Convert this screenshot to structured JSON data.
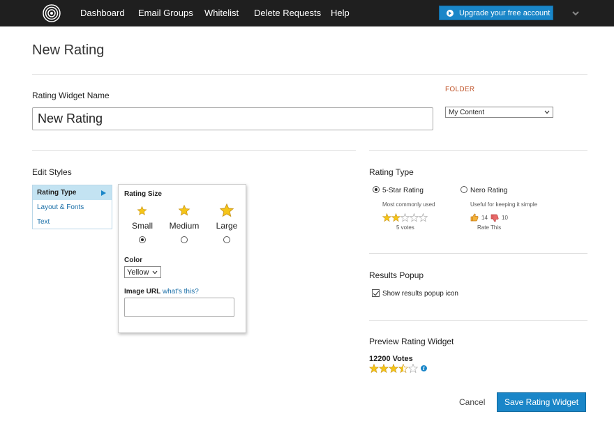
{
  "nav": {
    "items": [
      "Dashboard",
      "Email Groups",
      "Whitelist",
      "Delete Requests",
      "Help"
    ],
    "upgrade_label": "Upgrade your free account"
  },
  "page": {
    "title": "New Rating"
  },
  "widget_name": {
    "label": "Rating Widget Name",
    "value": "New Rating"
  },
  "folder": {
    "label": "FOLDER",
    "selected": "My Content"
  },
  "edit_styles": {
    "heading": "Edit Styles",
    "tabs": [
      "Rating Type",
      "Layout & Fonts",
      "Text"
    ],
    "active_tab": "Rating Type",
    "rating_size": {
      "heading": "Rating Size",
      "options": [
        "Small",
        "Medium",
        "Large"
      ],
      "selected": "Small"
    },
    "color": {
      "label": "Color",
      "selected": "Yellow"
    },
    "image_url": {
      "label": "Image URL",
      "help_link": "what's this?",
      "value": ""
    }
  },
  "rating_type": {
    "heading": "Rating Type",
    "five_star": {
      "label": "5-Star Rating",
      "description": "Most commonly used",
      "example_votes": "5 votes",
      "example_stars": 2,
      "selected": true
    },
    "nero": {
      "label": "Nero Rating",
      "description": "Useful for keeping it simple",
      "up_count": "14",
      "down_count": "10",
      "rate_label": "Rate This",
      "selected": false
    }
  },
  "results_popup": {
    "heading": "Results Popup",
    "checkbox_label": "Show results popup icon",
    "checked": true
  },
  "preview": {
    "heading": "Preview Rating Widget",
    "votes_text": "12200 Votes",
    "stars": 3.5,
    "info_icon": "i"
  },
  "actions": {
    "cancel_label": "Cancel",
    "save_label": "Save Rating Widget"
  },
  "colors": {
    "accent": "#1a86c8",
    "topbar": "#1f1f1f",
    "star": "#f5c518",
    "folder_label": "#c0542a"
  },
  "icons": [
    "logo-icon",
    "play-circle-icon",
    "chevron-down-icon",
    "star-icon",
    "thumbs-up-icon",
    "thumbs-down-icon",
    "info-icon",
    "checkmark-icon"
  ]
}
